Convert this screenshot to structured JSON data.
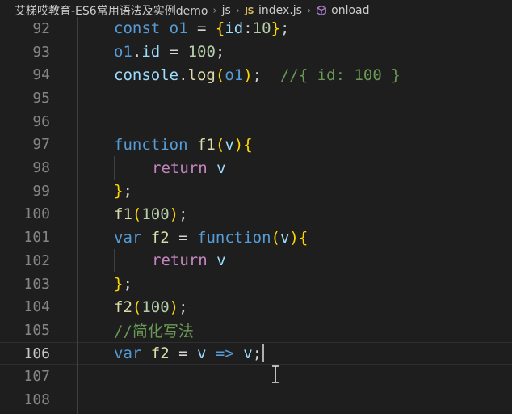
{
  "breadcrumb": {
    "folder": "艾梯哎教育-ES6常用语法及实例demo",
    "subfolder": "js",
    "file_badge": "JS",
    "file": "index.js",
    "symbol": "onload"
  },
  "colors": {
    "background": "#1e1e1e",
    "keyword": "#569cd6",
    "control": "#c586c0",
    "variable": "#9cdcfe",
    "function": "#dcdcaa",
    "number": "#b5cea8",
    "comment": "#6a9955",
    "bracket_level1": "#ffd700",
    "bracket_level2": "#da70d6"
  },
  "editor": {
    "current_line": "106",
    "lines": [
      {
        "number": "92",
        "tokens": [
          {
            "t": "const",
            "c": "kw"
          },
          {
            "t": " ",
            "c": "pun"
          },
          {
            "t": "o1",
            "c": "kw"
          },
          {
            "t": " = ",
            "c": "pun"
          },
          {
            "t": "{",
            "c": "br1"
          },
          {
            "t": "id",
            "c": "id"
          },
          {
            "t": ":",
            "c": "pun"
          },
          {
            "t": "10",
            "c": "num"
          },
          {
            "t": "}",
            "c": "br1"
          },
          {
            "t": ";",
            "c": "pun"
          }
        ]
      },
      {
        "number": "93",
        "tokens": [
          {
            "t": "o1",
            "c": "kw"
          },
          {
            "t": ".",
            "c": "pun"
          },
          {
            "t": "id",
            "c": "id"
          },
          {
            "t": " = ",
            "c": "pun"
          },
          {
            "t": "100",
            "c": "num"
          },
          {
            "t": ";",
            "c": "pun"
          }
        ]
      },
      {
        "number": "94",
        "tokens": [
          {
            "t": "console",
            "c": "id"
          },
          {
            "t": ".",
            "c": "pun"
          },
          {
            "t": "log",
            "c": "fn"
          },
          {
            "t": "(",
            "c": "br1"
          },
          {
            "t": "o1",
            "c": "kw"
          },
          {
            "t": ")",
            "c": "br1"
          },
          {
            "t": ";  ",
            "c": "pun"
          },
          {
            "t": "//{ id: 100 }",
            "c": "cm"
          }
        ]
      },
      {
        "number": "95",
        "tokens": []
      },
      {
        "number": "96",
        "tokens": []
      },
      {
        "number": "97",
        "tokens": [
          {
            "t": "function",
            "c": "kw"
          },
          {
            "t": " ",
            "c": "pun"
          },
          {
            "t": "f1",
            "c": "fn"
          },
          {
            "t": "(",
            "c": "br1"
          },
          {
            "t": "v",
            "c": "id"
          },
          {
            "t": ")",
            "c": "br1"
          },
          {
            "t": "{",
            "c": "br1"
          }
        ]
      },
      {
        "number": "98",
        "indent": 1,
        "tokens": [
          {
            "t": "return",
            "c": "ctl"
          },
          {
            "t": " ",
            "c": "pun"
          },
          {
            "t": "v",
            "c": "id"
          }
        ]
      },
      {
        "number": "99",
        "tokens": [
          {
            "t": "}",
            "c": "br1"
          },
          {
            "t": ";",
            "c": "pun"
          }
        ]
      },
      {
        "number": "100",
        "tokens": [
          {
            "t": "f1",
            "c": "fn"
          },
          {
            "t": "(",
            "c": "br1"
          },
          {
            "t": "100",
            "c": "num"
          },
          {
            "t": ")",
            "c": "br1"
          },
          {
            "t": ";",
            "c": "pun"
          }
        ]
      },
      {
        "number": "101",
        "tokens": [
          {
            "t": "var",
            "c": "kw"
          },
          {
            "t": " ",
            "c": "pun"
          },
          {
            "t": "f2",
            "c": "fn"
          },
          {
            "t": " = ",
            "c": "pun"
          },
          {
            "t": "function",
            "c": "kw"
          },
          {
            "t": "(",
            "c": "br1"
          },
          {
            "t": "v",
            "c": "id"
          },
          {
            "t": ")",
            "c": "br1"
          },
          {
            "t": "{",
            "c": "br1"
          }
        ]
      },
      {
        "number": "102",
        "indent": 1,
        "tokens": [
          {
            "t": "return",
            "c": "ctl"
          },
          {
            "t": " ",
            "c": "pun"
          },
          {
            "t": "v",
            "c": "id"
          }
        ]
      },
      {
        "number": "103",
        "tokens": [
          {
            "t": "}",
            "c": "br1"
          },
          {
            "t": ";",
            "c": "pun"
          }
        ]
      },
      {
        "number": "104",
        "tokens": [
          {
            "t": "f2",
            "c": "fn"
          },
          {
            "t": "(",
            "c": "br1"
          },
          {
            "t": "100",
            "c": "num"
          },
          {
            "t": ")",
            "c": "br1"
          },
          {
            "t": ";",
            "c": "pun"
          }
        ]
      },
      {
        "number": "105",
        "tokens": [
          {
            "t": "//简化写法",
            "c": "cm"
          }
        ]
      },
      {
        "number": "106",
        "caret": true,
        "tokens": [
          {
            "t": "var",
            "c": "kw"
          },
          {
            "t": " ",
            "c": "pun"
          },
          {
            "t": "f2",
            "c": "fn"
          },
          {
            "t": " = ",
            "c": "pun"
          },
          {
            "t": "v",
            "c": "id"
          },
          {
            "t": " ",
            "c": "pun"
          },
          {
            "t": "=>",
            "c": "kw"
          },
          {
            "t": " ",
            "c": "pun"
          },
          {
            "t": "v",
            "c": "id"
          },
          {
            "t": ";",
            "c": "pun"
          }
        ]
      },
      {
        "number": "107",
        "tokens": []
      },
      {
        "number": "108",
        "tokens": []
      }
    ]
  }
}
